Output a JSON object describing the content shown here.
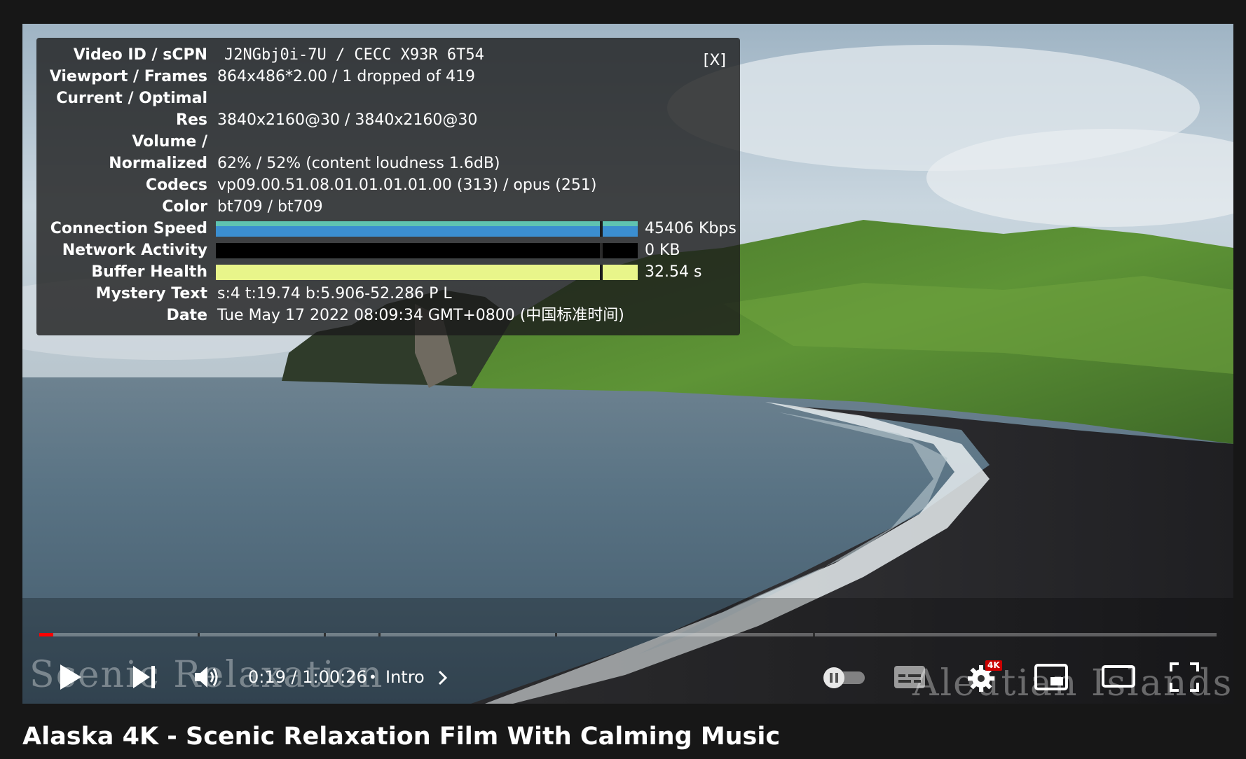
{
  "video": {
    "title": "Alaska 4K - Scenic Relaxation Film With Calming Music",
    "watermark_left": "Scenic Relaxation",
    "watermark_right": "Aleutian Islands"
  },
  "stats_panel": {
    "close_label": "[X]",
    "rows": [
      {
        "label": "Video ID / sCPN",
        "value": "J2NGbj0i-7U / CECC X93R 6T54"
      },
      {
        "label": "Viewport / Frames",
        "value": "864x486*2.00 / 1 dropped of 419"
      },
      {
        "label": "Current / Optimal",
        "value": ""
      },
      {
        "label": "Res",
        "value": "3840x2160@30 / 3840x2160@30"
      },
      {
        "label": "Volume /",
        "value": ""
      },
      {
        "label": "Normalized",
        "value": "62% / 52% (content loudness 1.6dB)"
      },
      {
        "label": "Codecs",
        "value": "vp09.00.51.08.01.01.01.01.00 (313) / opus (251)"
      },
      {
        "label": "Color",
        "value": "bt709 / bt709"
      },
      {
        "label": "Connection Speed",
        "value": "45406 Kbps"
      },
      {
        "label": "Network Activity",
        "value": "0 KB"
      },
      {
        "label": "Buffer Health",
        "value": "32.54 s"
      },
      {
        "label": "Mystery Text",
        "value": "s:4 t:19.74 b:5.906-52.286 P L"
      },
      {
        "label": "Date",
        "value": "Tue May 17 2022 08:09:34 GMT+0800 (中国标准时间)"
      }
    ]
  },
  "controls": {
    "time_display": "0:19 / 1:00:26",
    "separator": "•",
    "chapter": "Intro",
    "quality_badge": "4K",
    "progress_played": 0.012,
    "icons": {
      "play": "play-icon",
      "next": "next-icon",
      "volume": "volume-icon",
      "autoplay": "autoplay-toggle",
      "subtitles": "subtitles-icon",
      "settings": "settings-icon",
      "miniplayer": "miniplayer-icon",
      "theater": "theater-icon",
      "fullscreen": "fullscreen-icon"
    }
  },
  "colors": {
    "connection_bar_top": "#5fc3b1",
    "connection_bar_main": "#3b8ed0",
    "network_bar": "#000000",
    "buffer_bar": "#e8f58a",
    "progress_red": "#ff0000"
  }
}
